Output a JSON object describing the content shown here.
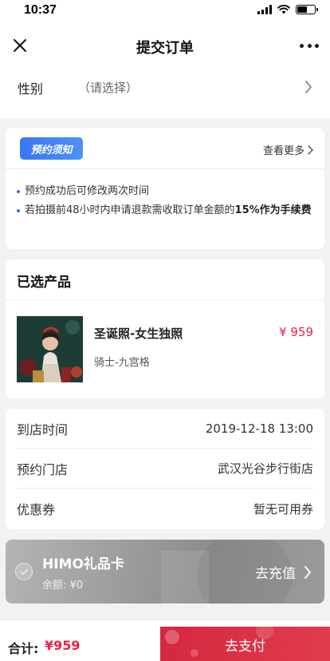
{
  "status_bar": {
    "time": "10:37"
  },
  "nav": {
    "title": "提交订单"
  },
  "gender": {
    "label": "性别",
    "value": "（请选择）"
  },
  "notice": {
    "tag": "预约须知",
    "more": "查看更多",
    "items": [
      {
        "text": "预约成功后可修改两次时间"
      },
      {
        "text_before": "若拍摄前48小时内申请退款需收取订单金额的",
        "text_bold": "15%作为手续费"
      }
    ]
  },
  "product": {
    "header": "已选产品",
    "name": "圣诞照-女生独照",
    "price": "¥ 959",
    "spec": "骑士-九宫格"
  },
  "info": {
    "rows": [
      {
        "label": "到店时间",
        "value": "2019-12-18 13:00"
      },
      {
        "label": "预约门店",
        "value": "武汉光谷步行街店"
      },
      {
        "label": "优惠券",
        "value": "暂无可用券"
      }
    ]
  },
  "gift_card": {
    "title": "HIMO礼品卡",
    "balance": "余额: ¥0",
    "recharge": "去充值"
  },
  "bottom": {
    "total_label": "合计:",
    "total_value": "¥959",
    "pay": "去支付"
  },
  "colors": {
    "accent_red": "#e6234a",
    "pay_red": "#d4283f",
    "tag_blue": "#3877f2",
    "stripe_orange": "#f59a24",
    "stripe_blue": "#3f6fd8"
  },
  "icons": [
    "close-icon",
    "more-icon",
    "chevron-right-icon",
    "check-circle-icon",
    "signal-icon",
    "wifi-icon",
    "battery-icon"
  ]
}
